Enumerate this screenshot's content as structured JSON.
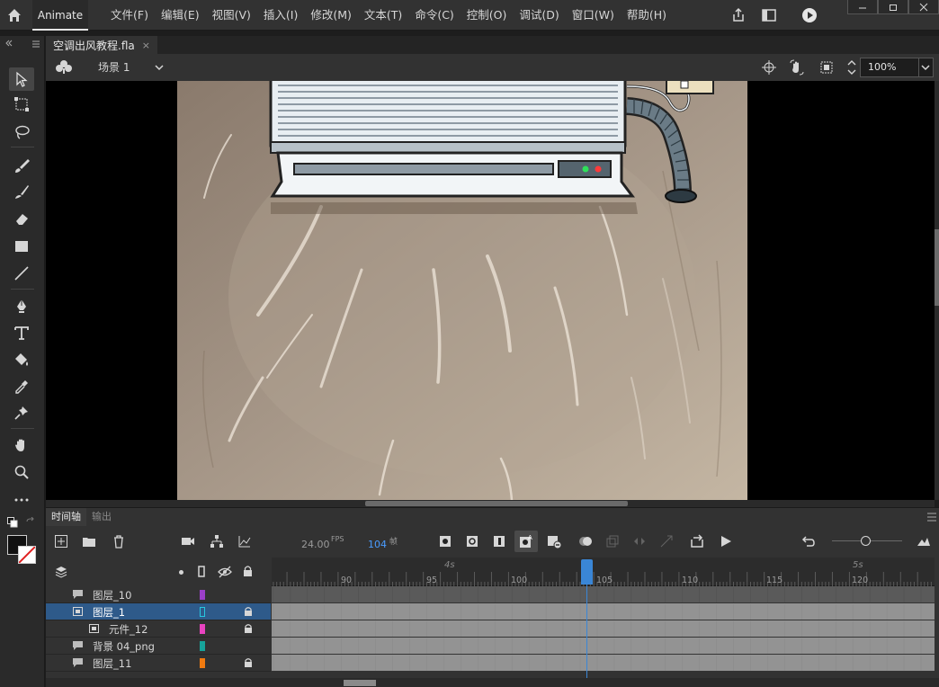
{
  "app": {
    "name": "Animate"
  },
  "menu": [
    "文件(F)",
    "编辑(E)",
    "视图(V)",
    "插入(I)",
    "修改(M)",
    "文本(T)",
    "命令(C)",
    "控制(O)",
    "调试(D)",
    "窗口(W)",
    "帮助(H)"
  ],
  "document": {
    "tab_title": "空调出风教程.fla",
    "close": "×"
  },
  "scene": {
    "label": "场景 1"
  },
  "zoom": {
    "value": "100%"
  },
  "timeline": {
    "tabs": [
      "时间轴",
      "输出"
    ],
    "fps": "24.00",
    "fps_unit": "FPS",
    "frame": "104",
    "frame_unit": "帧",
    "ruler_seconds": [
      "4s",
      "5s"
    ],
    "ruler_ticks": [
      "90",
      "95",
      "100",
      "105",
      "110",
      "115",
      "120"
    ],
    "current_frame": 104
  },
  "layers": [
    {
      "name": "图层_10",
      "color": "#9b3fc8",
      "selected": false,
      "locked": false,
      "indent": false
    },
    {
      "name": "图层_1",
      "color": "#27c7e0",
      "selected": true,
      "locked": true,
      "indent": false
    },
    {
      "name": "元件_12",
      "color": "#e843c0",
      "selected": false,
      "locked": true,
      "indent": true
    },
    {
      "name": "背景 04_png",
      "color": "#17a39a",
      "selected": false,
      "locked": false,
      "indent": false
    },
    {
      "name": "图层_11",
      "color": "#f07a10",
      "selected": false,
      "locked": true,
      "indent": false
    }
  ],
  "colors": {
    "accent": "#3a86d6",
    "stroke": "#111111",
    "fill": "#ffffff"
  }
}
